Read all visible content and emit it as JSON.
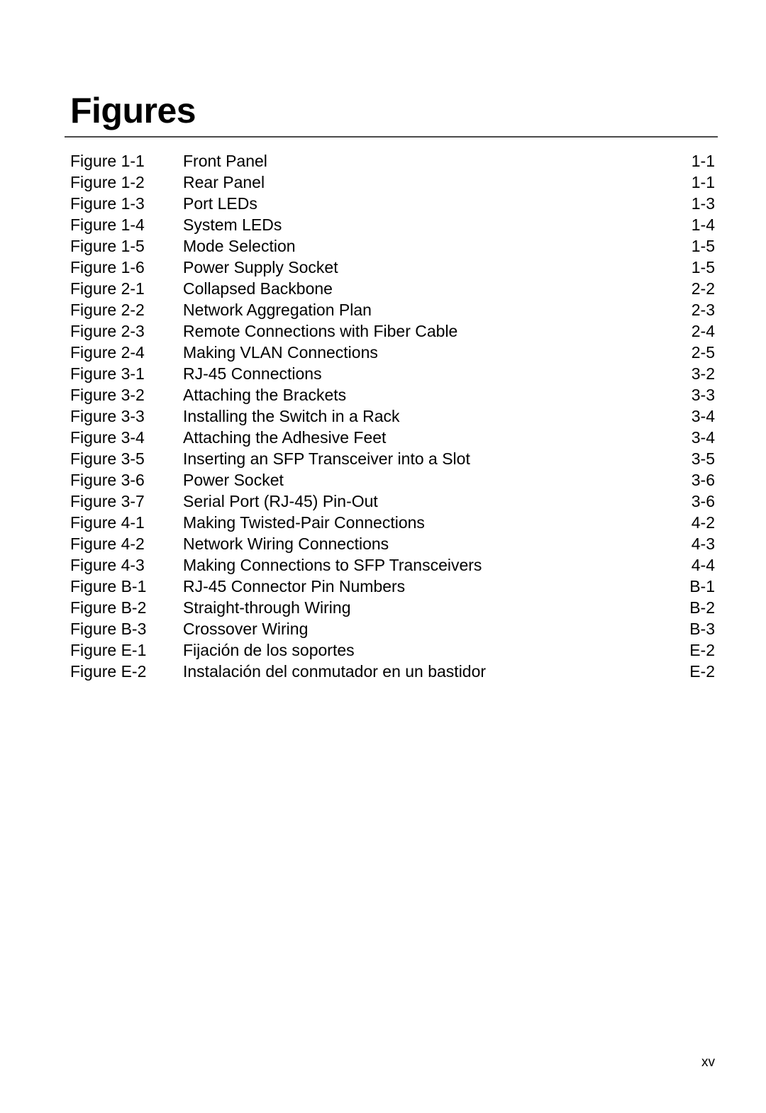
{
  "document": {
    "heading": "Figures",
    "folio": "xv"
  },
  "figure_list": {
    "entries": [
      {
        "label": "Figure 1-1",
        "title": "Front Panel",
        "page": "1-1"
      },
      {
        "label": "Figure 1-2",
        "title": "Rear Panel",
        "page": "1-1"
      },
      {
        "label": "Figure 1-3",
        "title": "Port LEDs",
        "page": "1-3"
      },
      {
        "label": "Figure 1-4",
        "title": "System LEDs",
        "page": "1-4"
      },
      {
        "label": "Figure 1-5",
        "title": "Mode Selection",
        "page": "1-5"
      },
      {
        "label": "Figure 1-6",
        "title": "Power Supply Socket",
        "page": "1-5"
      },
      {
        "label": "Figure 2-1",
        "title": "Collapsed Backbone",
        "page": "2-2"
      },
      {
        "label": "Figure 2-2",
        "title": "Network Aggregation Plan",
        "page": "2-3"
      },
      {
        "label": "Figure 2-3",
        "title": "Remote Connections with Fiber Cable",
        "page": "2-4"
      },
      {
        "label": "Figure 2-4",
        "title": "Making VLAN Connections",
        "page": "2-5"
      },
      {
        "label": "Figure 3-1",
        "title": "RJ-45 Connections",
        "page": "3-2"
      },
      {
        "label": "Figure 3-2",
        "title": "Attaching the Brackets",
        "page": "3-3"
      },
      {
        "label": "Figure 3-3",
        "title": "Installing the Switch in a Rack",
        "page": "3-4"
      },
      {
        "label": "Figure 3-4",
        "title": "Attaching the Adhesive Feet",
        "page": "3-4"
      },
      {
        "label": "Figure 3-5",
        "title": "Inserting an SFP Transceiver into a Slot",
        "page": "3-5"
      },
      {
        "label": "Figure 3-6",
        "title": "Power Socket",
        "page": "3-6"
      },
      {
        "label": "Figure 3-7",
        "title": "Serial Port (RJ-45) Pin-Out",
        "page": "3-6"
      },
      {
        "label": "Figure 4-1",
        "title": "Making Twisted-Pair Connections",
        "page": "4-2"
      },
      {
        "label": "Figure 4-2",
        "title": "Network Wiring Connections",
        "page": "4-3"
      },
      {
        "label": "Figure 4-3",
        "title": "Making Connections to SFP Transceivers",
        "page": "4-4"
      },
      {
        "label": "Figure B-1",
        "title": "RJ-45 Connector Pin Numbers",
        "page": "B-1"
      },
      {
        "label": "Figure B-2",
        "title": "Straight-through Wiring",
        "page": "B-2"
      },
      {
        "label": "Figure B-3",
        "title": "Crossover Wiring",
        "page": "B-3"
      },
      {
        "label": "Figure E-1",
        "title": "Fijación de los soportes",
        "page": "E-2"
      },
      {
        "label": "Figure E-2",
        "title": "Instalación del conmutador en un bastidor",
        "page": "E-2"
      }
    ]
  }
}
